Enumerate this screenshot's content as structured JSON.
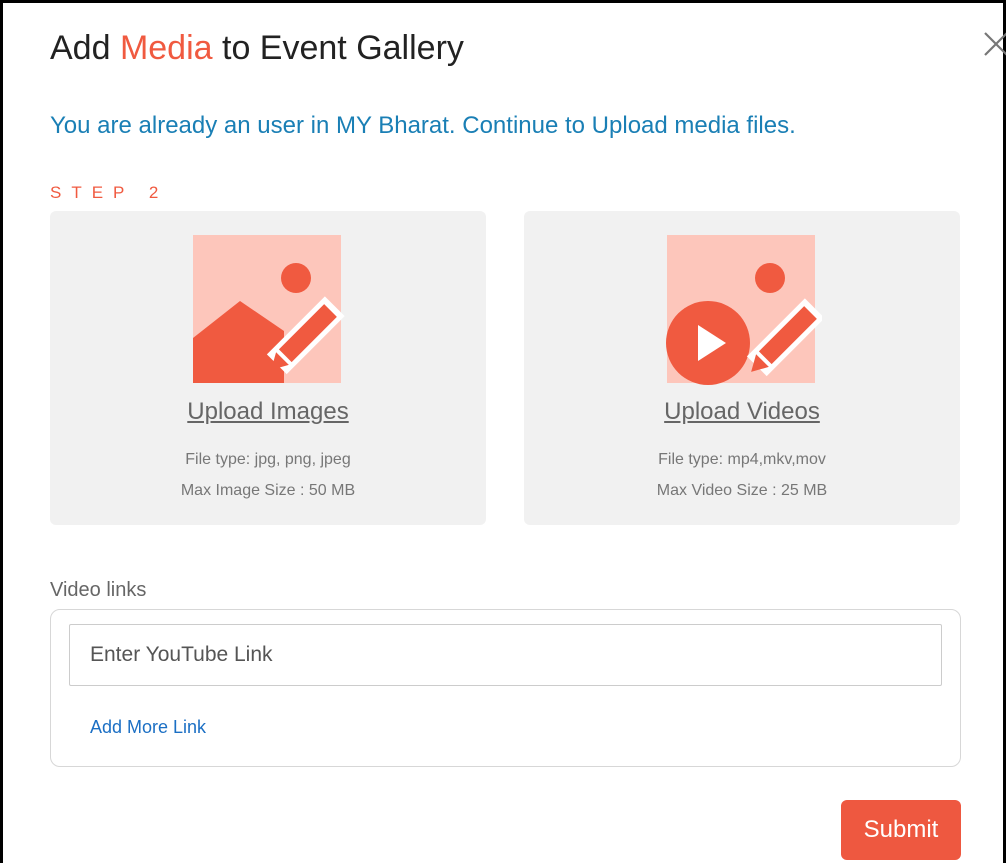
{
  "modal": {
    "title_prefix": "Add ",
    "title_accent": "Media",
    "title_suffix": " to Event Gallery",
    "close_icon": "close-icon",
    "subtitle": "You are already an user in MY Bharat. Continue to Upload media files.",
    "step_label": "STEP 2"
  },
  "upload_images": {
    "icon": "image-edit-icon",
    "link_label": "Upload Images",
    "file_type": "File type: jpg, png, jpeg",
    "max_size": "Max Image Size : 50 MB"
  },
  "upload_videos": {
    "icon": "video-edit-icon",
    "link_label": "Upload Videos",
    "file_type": "File type: mp4,mkv,mov",
    "max_size": "Max Video Size : 25 MB"
  },
  "video_links": {
    "label": "Video links",
    "input_value": "",
    "input_placeholder": "Enter YouTube Link",
    "add_more_label": "Add More Link"
  },
  "actions": {
    "submit_label": "Submit"
  },
  "colors": {
    "accent": "#f05a40",
    "link_blue": "#1a7fb5",
    "illustration_bg": "#fdc6bb",
    "card_bg": "#f1f1f1"
  }
}
